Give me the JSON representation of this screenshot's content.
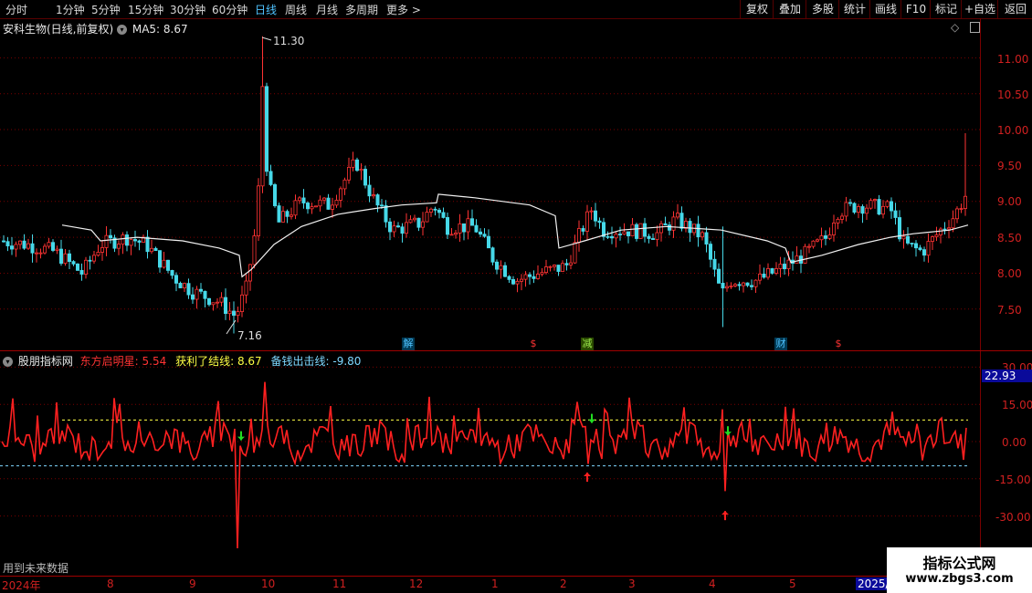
{
  "toolbar": {
    "periods": [
      "分时",
      "1分钟",
      "5分钟",
      "15分钟",
      "30分钟",
      "60分钟",
      "日线",
      "周线",
      "月线",
      "多周期",
      "更多"
    ],
    "active_period": "日线",
    "more_arrow": ">",
    "right_buttons": [
      "复权",
      "叠加",
      "多股",
      "统计",
      "画线",
      "F10",
      "标记",
      "+自选",
      "返回"
    ]
  },
  "main_chart": {
    "title": "安科生物(日线,前复权)",
    "ma_label": "MA5:",
    "ma_value": "8.67",
    "diamond_icon": "◇",
    "price_axis": [
      "11.00",
      "10.50",
      "10.00",
      "9.50",
      "9.00",
      "8.50",
      "8.00",
      "7.50"
    ],
    "high_label": "11.30",
    "low_label": "7.16",
    "events": [
      {
        "text": "解",
        "color": "#4fc3ff"
      },
      {
        "text": "$",
        "color": "#ff3333"
      },
      {
        "text": "减",
        "color": "#9bea4d"
      },
      {
        "text": "财",
        "color": "#4fc3ff"
      },
      {
        "text": "$",
        "color": "#ff3333"
      }
    ],
    "colors": {
      "up": "#ff3333",
      "down": "#46d8e8",
      "ma": "#f0f0f0",
      "grid": "#7a0000"
    }
  },
  "indicator": {
    "name": "股朋指标网",
    "l1_label": "东方启明星:",
    "l1_value": "5.54",
    "l2_label": "获利了结线:",
    "l2_value": "8.67",
    "l3_label": "备钱出击线:",
    "l3_value": "-9.80",
    "axis": [
      "30.00",
      "15.00",
      "0.00",
      "-15.00",
      "-30.00"
    ],
    "current_value": "22.93",
    "colors": {
      "line": "#ff2020",
      "upper": "#ffff44",
      "lower": "#7fd8ff",
      "buy_arrow": "#ff2020",
      "sell_arrow": "#22dd22"
    }
  },
  "footer": {
    "note": "用到未来数据",
    "dates": [
      "2024年",
      "8",
      "9",
      "10",
      "11",
      "12",
      "1",
      "2",
      "3",
      "4",
      "5",
      "2025/0"
    ]
  },
  "watermark": {
    "line1": "指标公式网",
    "line2": "www.zbgs3.com"
  },
  "chart_data": [
    {
      "type": "candlestick",
      "title": "安科生物(日线,前复权)",
      "y_axis_ticks": [
        7.5,
        8.0,
        8.5,
        9.0,
        9.5,
        10.0,
        10.5,
        11.0
      ],
      "ylim": [
        7.0,
        11.5
      ],
      "annotations": {
        "high": 11.3,
        "low": 7.16
      },
      "series": [
        {
          "name": "MA5",
          "last_value": 8.67
        }
      ],
      "grid": true
    },
    {
      "type": "line",
      "title": "股朋指标网",
      "ylim": [
        -36,
        36
      ],
      "y_axis_ticks": [
        30,
        15,
        0,
        -15,
        -30
      ],
      "series": [
        {
          "name": "东方启明星",
          "last_value": 5.54
        },
        {
          "name": "获利了结线",
          "last_value": 8.67
        },
        {
          "name": "备钱出击线",
          "last_value": -9.8
        }
      ],
      "current_value": 22.93,
      "grid": true
    }
  ]
}
